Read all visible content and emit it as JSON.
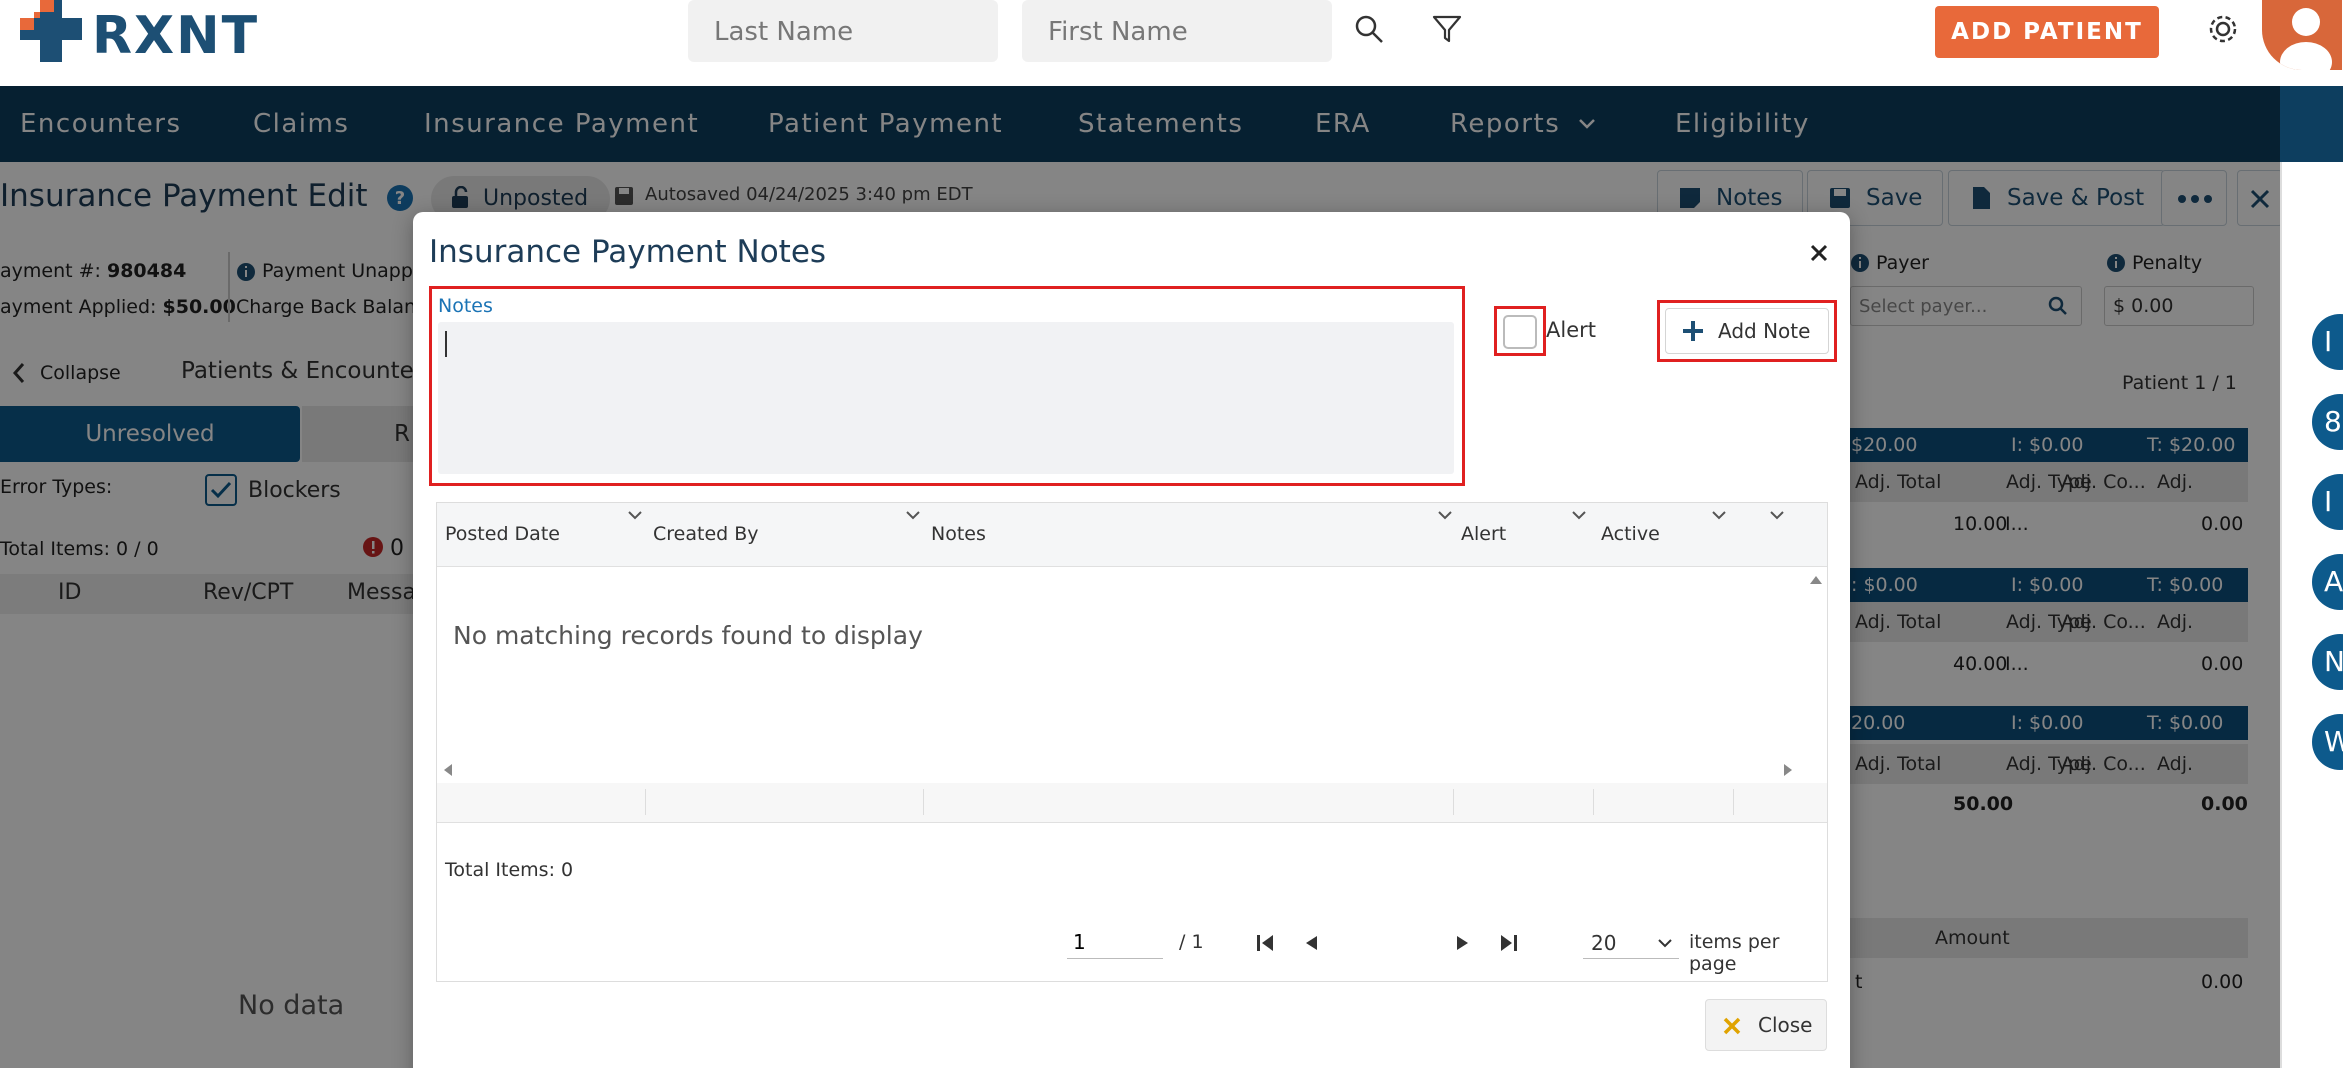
{
  "header": {
    "logo_text": "RXNT",
    "last_name_placeholder": "Last Name",
    "first_name_placeholder": "First Name",
    "add_patient_label": "ADD PATIENT"
  },
  "nav": {
    "items": [
      "Encounters",
      "Claims",
      "Insurance Payment",
      "Patient Payment",
      "Statements",
      "ERA",
      "Reports",
      "Eligibility"
    ]
  },
  "page": {
    "title": "Insurance Payment Edit",
    "status": "Unposted",
    "autosaved": "Autosaved 04/24/2025 3:40 pm EDT",
    "buttons": {
      "notes": "Notes",
      "save": "Save",
      "save_post": "Save & Post"
    },
    "payment_number_label": "ayment #:",
    "payment_number": "980484",
    "payment_applied_label": "ayment Applied:",
    "payment_applied": "$50.00",
    "payment_unapplied_label": "Payment Unappl",
    "charge_back_label": "Charge Back Balanc",
    "payer_label": "Payer",
    "payer_placeholder": "Select payer...",
    "penalty_label": "Penalty",
    "penalty_value": "$ 0.00"
  },
  "left_panel": {
    "collapse_label": "Collapse",
    "section_title": "Patients & Encounters",
    "tab_unresolved": "Unresolved",
    "tab_resolved": "R",
    "error_types_label": "Error Types:",
    "blockers_label": "Blockers",
    "total_items": "Total Items: 0 / 0",
    "error_count": "0",
    "columns": [
      "ID",
      "Rev/CPT",
      "Messa"
    ],
    "no_data": "No data"
  },
  "right_panel": {
    "patient_pager": "Patient 1 / 1",
    "groups": [
      {
        "summary": [
          "$20.00",
          "I: $0.00",
          "T: $20.00"
        ],
        "cols": [
          "Adj. Total",
          "Adj. Type",
          "Adj. Co...",
          "Adj."
        ],
        "vals": [
          "10.00",
          "I...",
          "",
          "0.00"
        ]
      },
      {
        "summary": [
          ": $0.00",
          "I: $0.00",
          "T: $0.00"
        ],
        "cols": [
          "Adj. Total",
          "Adj. Type",
          "Adj. Co...",
          "Adj."
        ],
        "vals": [
          "40.00",
          "I...",
          "",
          "0.00"
        ]
      },
      {
        "summary": [
          "20.00",
          "I: $0.00",
          "T: $0.00"
        ],
        "cols": [
          "Adj. Total",
          "Adj. Type",
          "Adj. Co...",
          "Adj."
        ],
        "vals": [
          "50.00",
          "",
          "",
          "0.00"
        ]
      }
    ],
    "amount_label": "Amount",
    "amount_value": "0.00",
    "amount_prefix": "t"
  },
  "right_rail": {
    "letters": [
      "I",
      "8",
      "I",
      "A",
      "N",
      "W"
    ]
  },
  "modal": {
    "title": "Insurance Payment Notes",
    "notes_label": "Notes",
    "notes_value": "",
    "alert_label": "Alert",
    "add_note_label": "Add Note",
    "columns": [
      "Posted Date",
      "Created By",
      "Notes",
      "Alert",
      "Active"
    ],
    "empty_message": "No matching records found to display",
    "total_items": "Total Items: 0",
    "page_value": "1",
    "page_total": "/ 1",
    "page_size": "20",
    "items_per_page": "items per page",
    "close_label": "Close"
  },
  "colors": {
    "brand_navy": "#0d3e5f",
    "accent_orange": "#e8693a",
    "highlight_red": "#e02020",
    "link_blue": "#1a73b5"
  }
}
